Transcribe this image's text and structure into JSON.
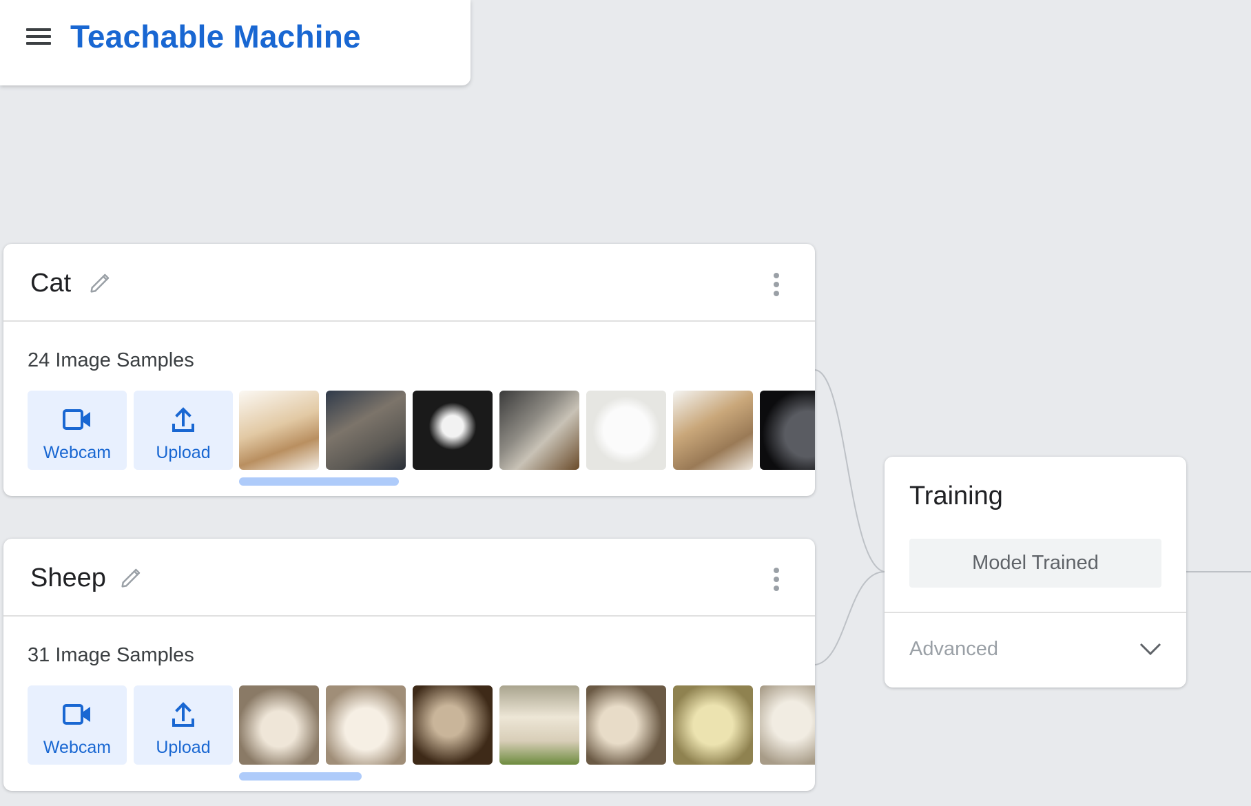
{
  "app": {
    "title": "Teachable Machine"
  },
  "classes": [
    {
      "name": "Cat",
      "sample_count_label": "24 Image Samples",
      "webcam_label": "Webcam",
      "upload_label": "Upload",
      "thumbnails": [
        "cat-photo",
        "cat-photo",
        "cat-photo",
        "cat-photo",
        "cat-photo",
        "cat-photo",
        "cat-photo"
      ],
      "scroll_fraction_visible": 0.25
    },
    {
      "name": "Sheep",
      "sample_count_label": "31 Image Samples",
      "webcam_label": "Webcam",
      "upload_label": "Upload",
      "thumbnails": [
        "sheep-photo",
        "sheep-photo",
        "sheep-photo",
        "sheep-photo",
        "sheep-photo",
        "sheep-photo",
        "sheep-photo"
      ],
      "scroll_fraction_visible": 0.19
    }
  ],
  "training": {
    "title": "Training",
    "button_label": "Model Trained",
    "advanced_label": "Advanced"
  },
  "colors": {
    "accent": "#1967d2",
    "background": "#e8eaed",
    "button_bg": "#e8f0fe",
    "scroll_thumb": "#aecbfa"
  }
}
